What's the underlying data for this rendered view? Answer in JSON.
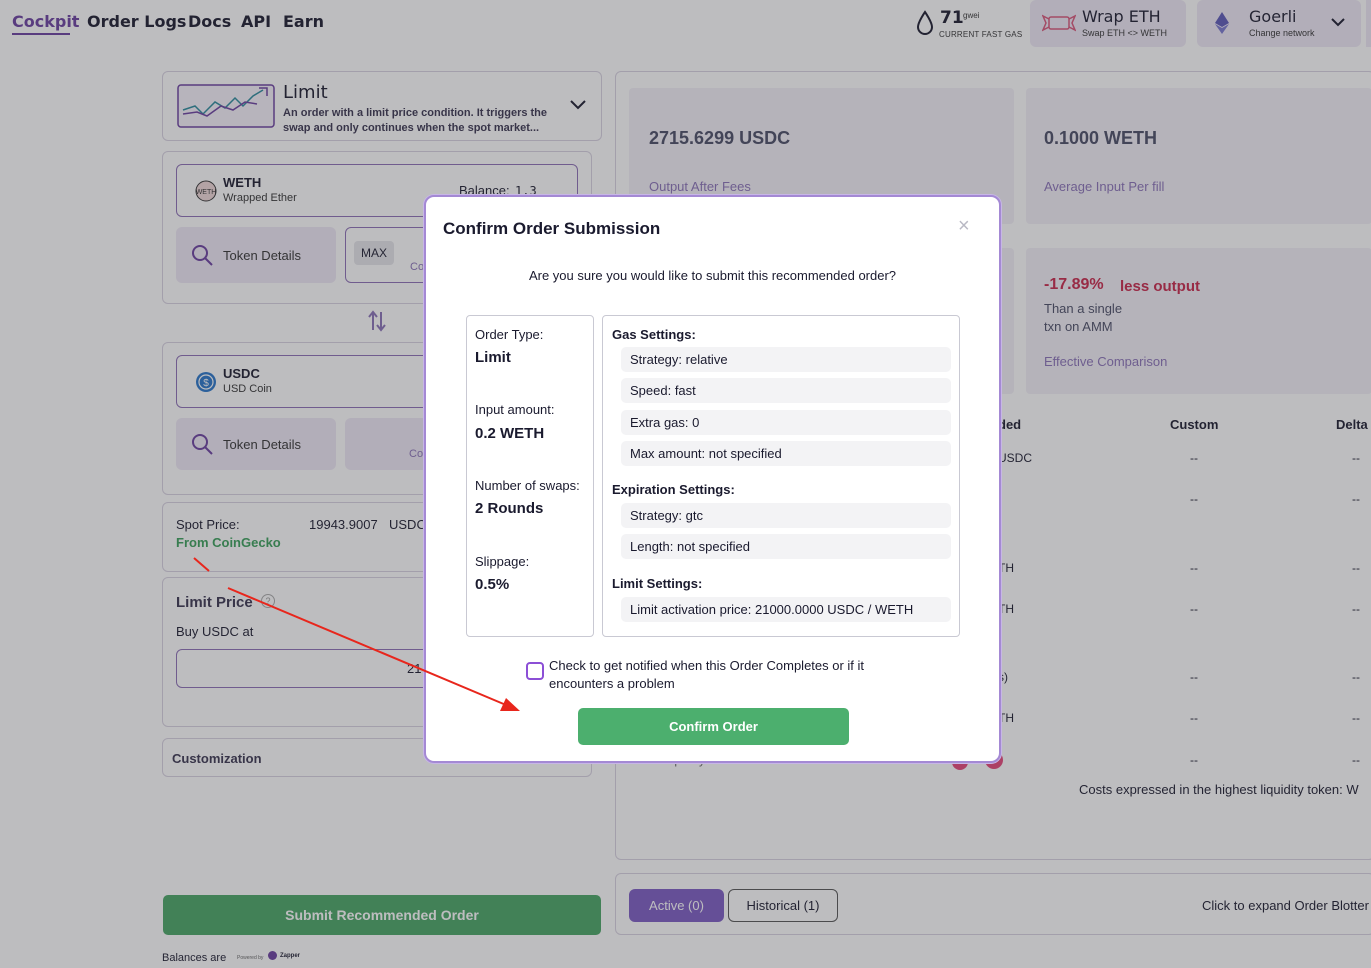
{
  "nav": {
    "links": [
      "Cockpit",
      "Order Logs",
      "Docs",
      "API",
      "Earn"
    ],
    "gas_value": "71",
    "gas_unit": "gwei",
    "gas_label": "CURRENT FAST GAS",
    "wrap_title": "Wrap ETH",
    "wrap_sub": "Swap ETH <> WETH",
    "network_title": "Goerli",
    "network_sub": "Change network"
  },
  "order_type": {
    "title": "Limit",
    "description": "An order with a limit price condition. It triggers the swap and only continues when the spot market..."
  },
  "input_token": {
    "name": "WETH",
    "full_name": "Wrapped Ether",
    "balance_label": "Balance:",
    "balance_value": "1.3",
    "details_label": "Token Details",
    "max_label": "MAX",
    "co_fragment": "Co"
  },
  "output_token": {
    "name": "USDC",
    "full_name": "USD Coin",
    "details_label": "Token Details",
    "co_fragment": "Co"
  },
  "spot": {
    "label": "Spot Price:",
    "value": "19943.9007",
    "unit": "USDC",
    "source": "From CoinGecko"
  },
  "limit_price": {
    "title": "Limit Price",
    "help": "?",
    "sub": "Buy USDC at",
    "value_fragment": "21"
  },
  "customization_label": "Customization",
  "submit_label": "Submit Recommended Order",
  "balances_note": "Balances are",
  "zapper_note": "Powered by",
  "zapper_name": "Zapper",
  "stats": {
    "output_value": "2715.6299 USDC",
    "output_label": "Output After Fees",
    "avg_value": "0.1000 WETH",
    "avg_label": "Average Input Per fill",
    "comparison_value": "-17.89%",
    "comparison_suffix": "less output",
    "comparison_sub1": "Than a single",
    "comparison_sub2": "txn on AMM",
    "comparison_label": "Effective Comparison"
  },
  "table": {
    "headers": [
      "ded",
      "Custom",
      "Delta"
    ],
    "row_fragments": [
      "USDC",
      "",
      "",
      "TH",
      "TH",
      "",
      "s)",
      "TH",
      ""
    ],
    "dash": "--",
    "footer_fragment": "Liquidity Sources",
    "costs_note": "Costs expressed in the highest liquidity token: W"
  },
  "blotter": {
    "active_label": "Active (0)",
    "historical_label": "Historical (1)",
    "expand_label": "Click to expand Order Blotter"
  },
  "modal": {
    "title": "Confirm Order Submission",
    "close": "×",
    "question": "Are you sure you would like to submit this recommended order?",
    "summary": [
      {
        "label": "Order Type:",
        "value": "Limit"
      },
      {
        "label": "Input amount:",
        "value": "0.2 WETH"
      },
      {
        "label": "Number of swaps:",
        "value": "2 Rounds"
      },
      {
        "label": "Slippage:",
        "value": "0.5%"
      }
    ],
    "gas_heading": "Gas Settings:",
    "gas_rows": [
      "Strategy: relative",
      "Speed: fast",
      "Extra gas: 0",
      "Max amount: not specified"
    ],
    "expiration_heading": "Expiration Settings:",
    "expiration_rows": [
      "Strategy: gtc",
      "Length: not specified"
    ],
    "limit_heading": "Limit Settings:",
    "limit_rows": [
      "Limit activation price: 21000.0000 USDC / WETH"
    ],
    "notify_label": "Check to get notified when this Order Completes or if it encounters a problem",
    "confirm_label": "Confirm Order"
  },
  "colors": {
    "accent": "#6b3fa0",
    "confirm_green": "#4caf6e",
    "negative_red": "#c8264a",
    "annotation_red": "#e8261c"
  }
}
